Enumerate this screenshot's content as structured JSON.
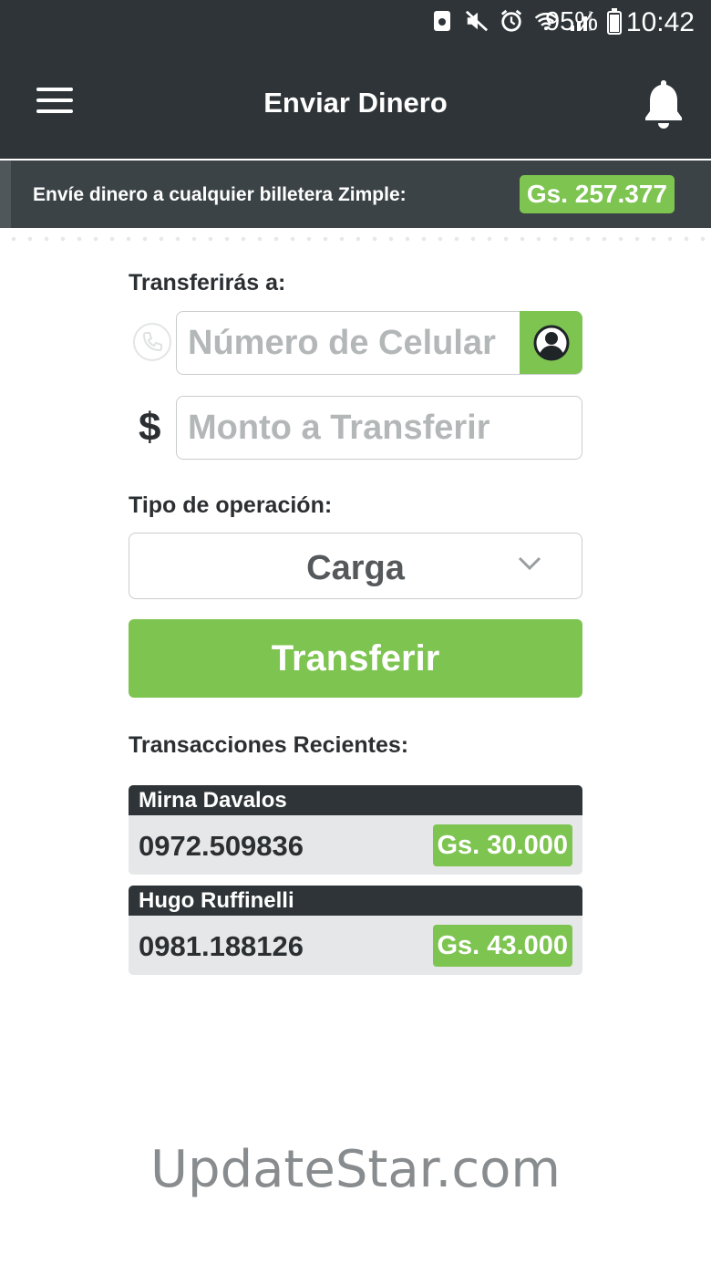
{
  "status_bar": {
    "battery": "95%",
    "time": "10:42"
  },
  "header": {
    "title": "Enviar Dinero",
    "menu_icon": "hamburger-icon",
    "notifications_icon": "bell-icon"
  },
  "banner": {
    "text": "Envíe dinero a cualquier billetera Zimple:",
    "balance": "Gs. 257.377"
  },
  "form": {
    "recipient_label": "Transferirás a:",
    "phone_placeholder": "Número de Celular",
    "phone_value": "",
    "amount_symbol": "$",
    "amount_placeholder": "Monto a Transferir",
    "amount_value": "",
    "operation_label": "Tipo de operación:",
    "operation_selected": "Carga",
    "submit_label": "Transferir"
  },
  "recent": {
    "title": "Transacciones Recientes:",
    "items": [
      {
        "name": "Mirna Davalos",
        "phone": "0972.509836",
        "amount": "Gs. 30.000"
      },
      {
        "name": "Hugo Ruffinelli",
        "phone": "0981.188126",
        "amount": "Gs. 43.000"
      }
    ]
  },
  "watermark": "UpdateStar.com",
  "colors": {
    "accent": "#7dc450",
    "header": "#2e3437",
    "banner": "#3c4346"
  }
}
